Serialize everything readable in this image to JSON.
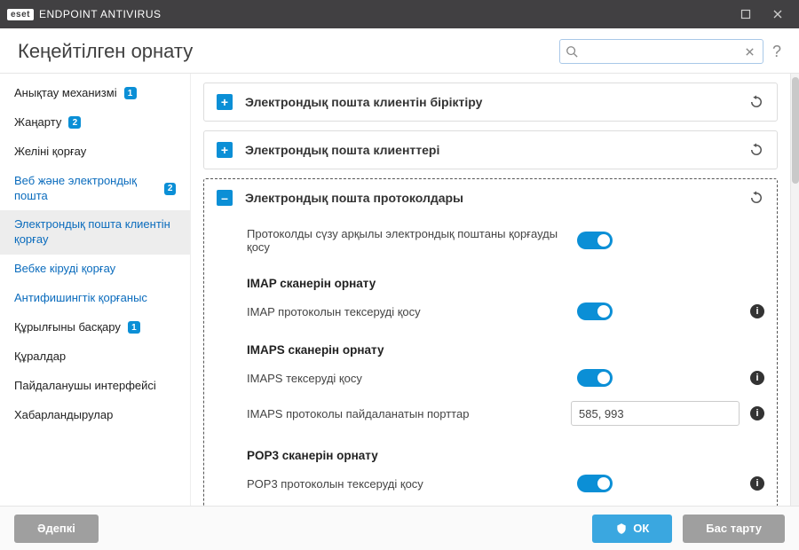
{
  "titlebar": {
    "brand_tag": "eset",
    "product_name": "ENDPOINT ANTIVIRUS"
  },
  "header": {
    "title": "Кеңейтілген орнату",
    "search_value": "",
    "help_label": "?"
  },
  "sidebar": {
    "items": [
      {
        "label": "Анықтау механизмі",
        "badge": "1"
      },
      {
        "label": "Жаңарту",
        "badge": "2"
      },
      {
        "label": "Желіні қорғау"
      },
      {
        "label": "Веб және электрондық пошта",
        "badge": "2"
      },
      {
        "label": "Электрондық пошта клиентін қорғау"
      },
      {
        "label": "Вебке кіруді қорғау"
      },
      {
        "label": "Антифишингтік қорғаныс"
      },
      {
        "label": "Құрылғыны басқару",
        "badge": "1"
      },
      {
        "label": "Құралдар"
      },
      {
        "label": "Пайдаланушы интерфейсі"
      },
      {
        "label": "Хабарландырулар"
      }
    ]
  },
  "content": {
    "sections": [
      {
        "title": "Электрондық пошта клиентін біріктіру"
      },
      {
        "title": "Электрондық пошта клиенттері"
      },
      {
        "title": "Электрондық пошта протоколдары"
      }
    ],
    "settings": {
      "enable_filter_label": "Протоколды сүзу арқылы электрондық поштаны қорғауды қосу",
      "imap_group": "IMAP сканерін орнату",
      "imap_check_label": "IMAP протоколын тексеруді қосу",
      "imaps_group": "IMAPS сканерін орнату",
      "imaps_check_label": "IMAPS тексеруді қосу",
      "imaps_ports_label": "IMAPS протоколы пайдаланатын порттар",
      "imaps_ports_value": "585, 993",
      "pop3_group": "POP3 сканерін орнату",
      "pop3_check_label": "POP3 протоколын тексеруді қосу"
    }
  },
  "footer": {
    "default_label": "Әдепкі",
    "ok_label": "ОК",
    "cancel_label": "Бас тарту"
  }
}
